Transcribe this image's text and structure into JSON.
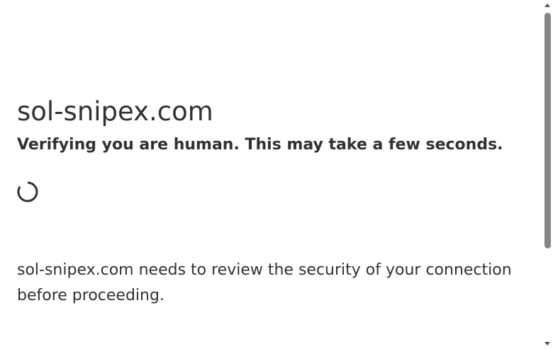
{
  "page": {
    "site_title": "sol-snipex.com",
    "subtitle": "Verifying you are human. This may take a few seconds.",
    "message": "sol-snipex.com needs to review the security of your connection before proceeding."
  },
  "spinner": {
    "icon": "loading-spinner-icon",
    "color": "#313131"
  },
  "colors": {
    "text": "#313131",
    "background": "#ffffff",
    "scroll_thumb": "#868686"
  }
}
